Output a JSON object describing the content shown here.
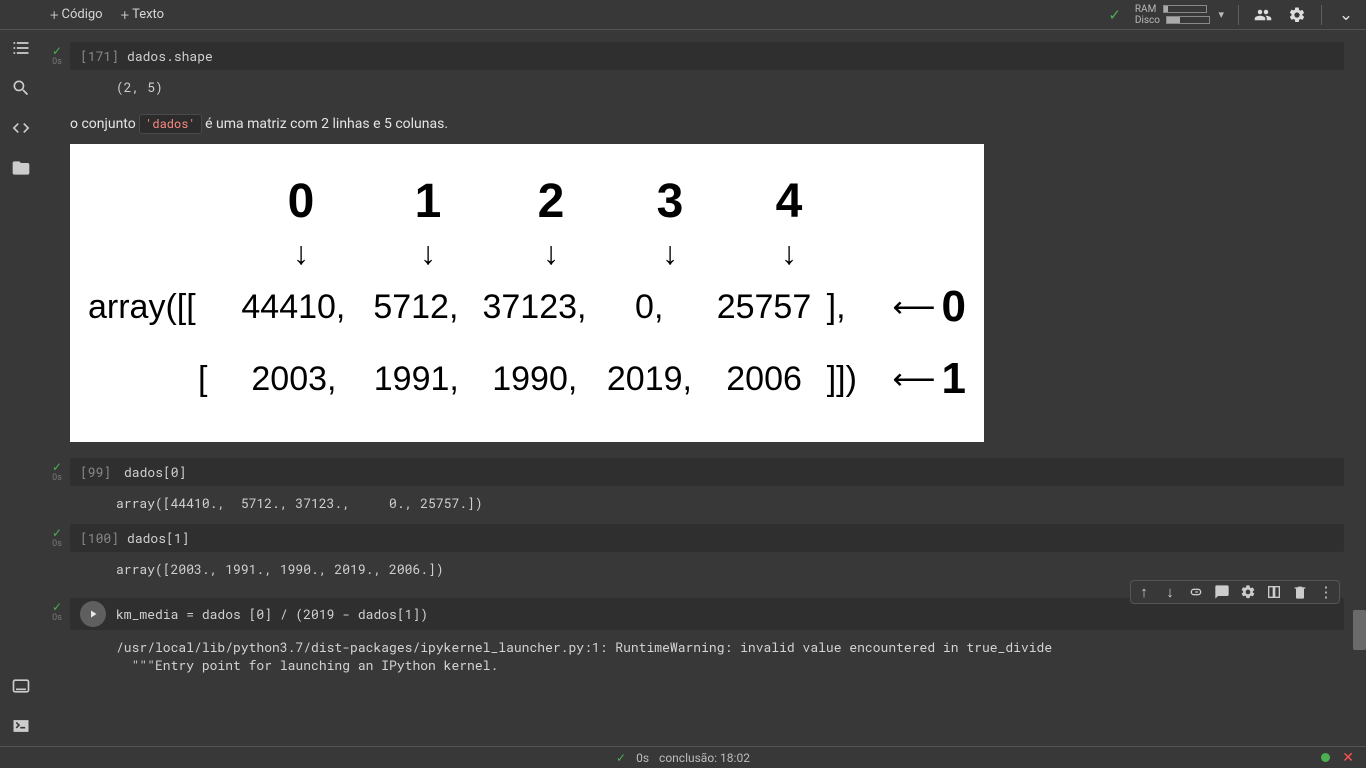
{
  "toolbar": {
    "add_code": "Código",
    "add_text": "Texto"
  },
  "resources": {
    "ram_label": "RAM",
    "disk_label": "Disco",
    "ram_fill_pct": 10,
    "disk_fill_pct": 30
  },
  "cells": [
    {
      "exec": "[171]",
      "time": "0s",
      "code": "dados.shape",
      "output": "(2, 5)"
    },
    {
      "type": "markdown",
      "pre": "o conjunto ",
      "code_token": "'dados'",
      "post": " é uma matriz com 2 linhas e 5 colunas."
    },
    {
      "exec": "[99]",
      "time": "0s",
      "code": "dados[0]",
      "output": "array([44410.,  5712., 37123.,     0., 25757.])"
    },
    {
      "exec": "[100]",
      "time": "0s",
      "code": "dados[1]",
      "output": "array([2003., 1991., 1990., 2019., 2006.])"
    },
    {
      "exec": "",
      "time": "0s",
      "code": "km_media = dados [0] / (2019 - dados[1])",
      "output": "/usr/local/lib/python3.7/dist-packages/ipykernel_launcher.py:1: RuntimeWarning: invalid value encountered in true_divide\n  \"\"\"Entry point for launching an IPython kernel."
    }
  ],
  "diagram": {
    "col_headers": [
      "0",
      "1",
      "2",
      "3",
      "4"
    ],
    "prefix": "array([[",
    "row0": [
      "44410,",
      "5712,",
      "37123,",
      "0,",
      "25757"
    ],
    "row0_close": "],",
    "row0_tag": "0",
    "row1_prefix": "[",
    "row1": [
      "2003,",
      "1991,",
      "1990,",
      "2019,",
      "2006"
    ],
    "row1_close": "]])",
    "row1_tag": "1"
  },
  "status": {
    "exec_time": "0s",
    "completion": "conclusão: 18:02"
  }
}
